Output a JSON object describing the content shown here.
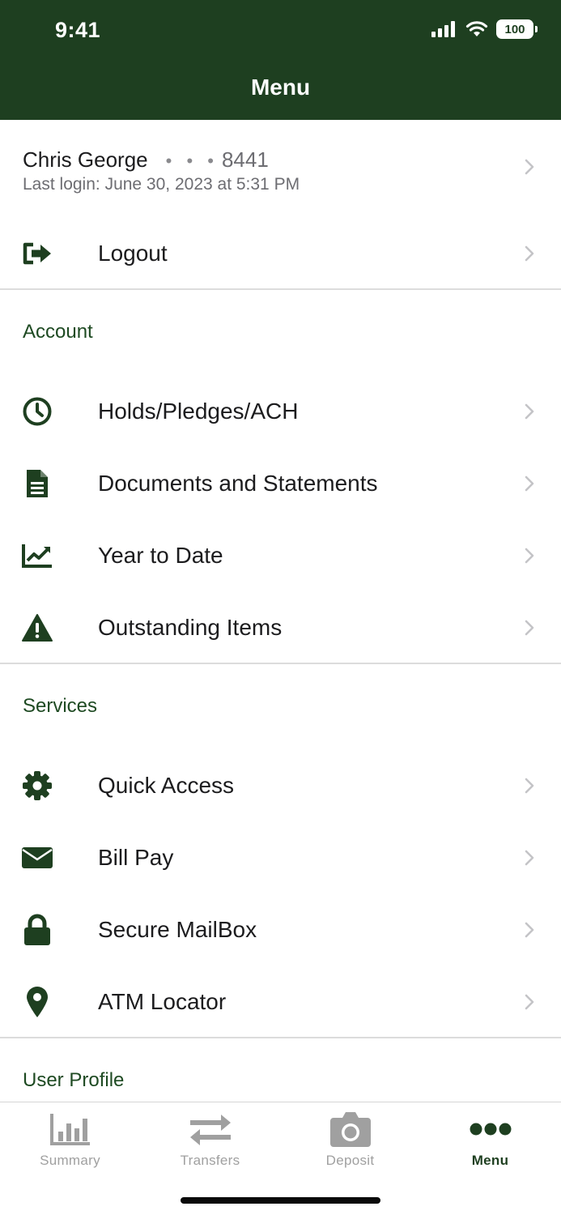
{
  "status_bar": {
    "time": "9:41",
    "battery": "100",
    "icons": [
      "signal-icon",
      "wifi-icon",
      "battery-icon"
    ]
  },
  "header": {
    "title": "Menu"
  },
  "user": {
    "name": "Chris George",
    "masked": "• • •",
    "account_last4": "8441",
    "last_login": "Last login: June 30, 2023 at 5:31 PM"
  },
  "logout": {
    "label": "Logout",
    "icon": "logout-icon"
  },
  "sections": {
    "account": {
      "title": "Account",
      "items": [
        {
          "label": "Holds/Pledges/ACH",
          "icon": "clock-icon"
        },
        {
          "label": "Documents and Statements",
          "icon": "document-icon"
        },
        {
          "label": "Year to Date",
          "icon": "chart-line-icon"
        },
        {
          "label": "Outstanding Items",
          "icon": "warning-icon"
        }
      ]
    },
    "services": {
      "title": "Services",
      "items": [
        {
          "label": "Quick Access",
          "icon": "gear-icon"
        },
        {
          "label": "Bill Pay",
          "icon": "envelope-icon"
        },
        {
          "label": "Secure MailBox",
          "icon": "lock-icon"
        },
        {
          "label": "ATM Locator",
          "icon": "map-pin-icon"
        }
      ]
    },
    "user_profile": {
      "title": "User Profile"
    }
  },
  "tabbar": {
    "tabs": [
      {
        "label": "Summary",
        "icon": "bar-chart-icon",
        "active": false
      },
      {
        "label": "Transfers",
        "icon": "transfer-arrows-icon",
        "active": false
      },
      {
        "label": "Deposit",
        "icon": "camera-icon",
        "active": false
      },
      {
        "label": "Menu",
        "icon": "more-dots-icon",
        "active": true
      }
    ]
  },
  "colors": {
    "brand": "#1e3f20",
    "section_text": "#1e4a22",
    "inactive_tab": "#a0a0a0",
    "divider": "#dcdcdc"
  }
}
